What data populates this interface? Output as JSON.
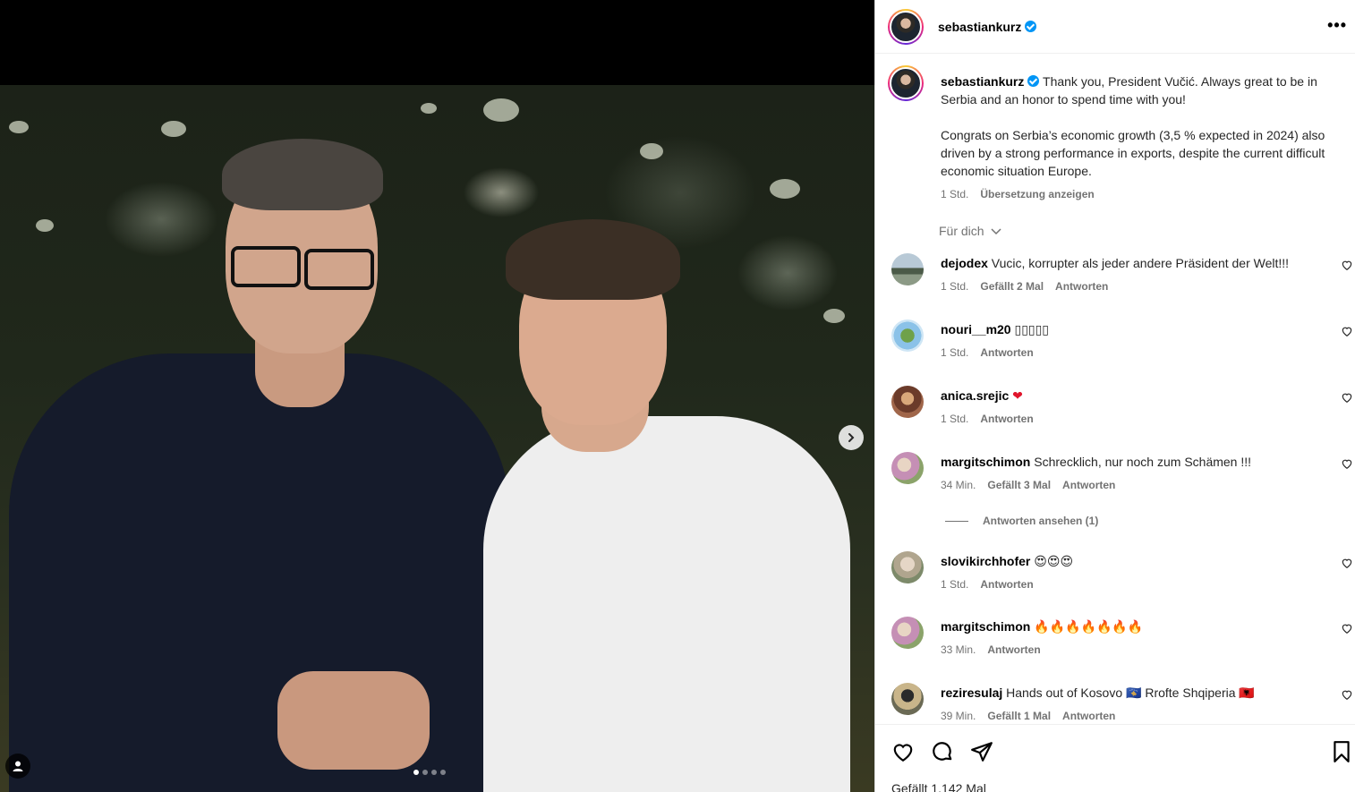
{
  "post": {
    "author": "sebastiankurz",
    "caption_lines": [
      "Thank you, President Vučić. Always great to be in Serbia and an honor to spend time with you!",
      "Congrats on Serbia’s economic growth (3,5 % expected in 2024) also driven by a strong performance in exports, despite the current difficult economic situation Europe."
    ],
    "caption_time": "1 Std.",
    "translate_label": "Übersetzung anzeigen",
    "likes_label": "Gefällt 1.142 Mal",
    "more_label": "•••"
  },
  "sort": {
    "label": "Für dich"
  },
  "replies_toggle": {
    "label": "Antworten ansehen (1)"
  },
  "comments": [
    {
      "user": "dejodex",
      "text": "Vucic, korrupter als jeder andere Präsident der Welt!!!",
      "time": "1 Std.",
      "likes": "Gefällt 2 Mal",
      "reply": "Antworten"
    },
    {
      "user": "nouri__m20",
      "text": "▯▯▯▯▯",
      "time": "1 Std.",
      "likes": "",
      "reply": "Antworten"
    },
    {
      "user": "anica.srejic",
      "text": "❤",
      "time": "1 Std.",
      "likes": "",
      "reply": "Antworten"
    },
    {
      "user": "margitschimon",
      "text": "Schrecklich, nur noch zum Schämen !!!",
      "time": "34 Min.",
      "likes": "Gefällt 3 Mal",
      "reply": "Antworten"
    },
    {
      "user": "slovikirchhofer",
      "text": "😍😍😍",
      "time": "1 Std.",
      "likes": "",
      "reply": "Antworten"
    },
    {
      "user": "margitschimon",
      "text": "🔥🔥🔥🔥🔥🔥🔥",
      "time": "33 Min.",
      "likes": "",
      "reply": "Antworten"
    },
    {
      "user": "reziresulaj",
      "text": "Hands out of Kosovo 🇽🇰 Rrofte Shqiperia 🇦🇱",
      "time": "39 Min.",
      "likes": "Gefällt 1 Mal",
      "reply": "Antworten"
    }
  ],
  "icons": {
    "verified": "verified-badge-icon",
    "more": "more-options-icon",
    "like": "heart-icon",
    "comment": "comment-bubble-icon",
    "share": "paper-plane-icon",
    "save": "bookmark-icon",
    "next": "chevron-right-icon",
    "tag": "user-tag-icon",
    "sort_chevron": "chevron-down-icon"
  },
  "carousel": {
    "count": 4,
    "active": 0
  },
  "colors": {
    "verified": "#0095f6",
    "meta": "#737373",
    "text": "#262626"
  }
}
